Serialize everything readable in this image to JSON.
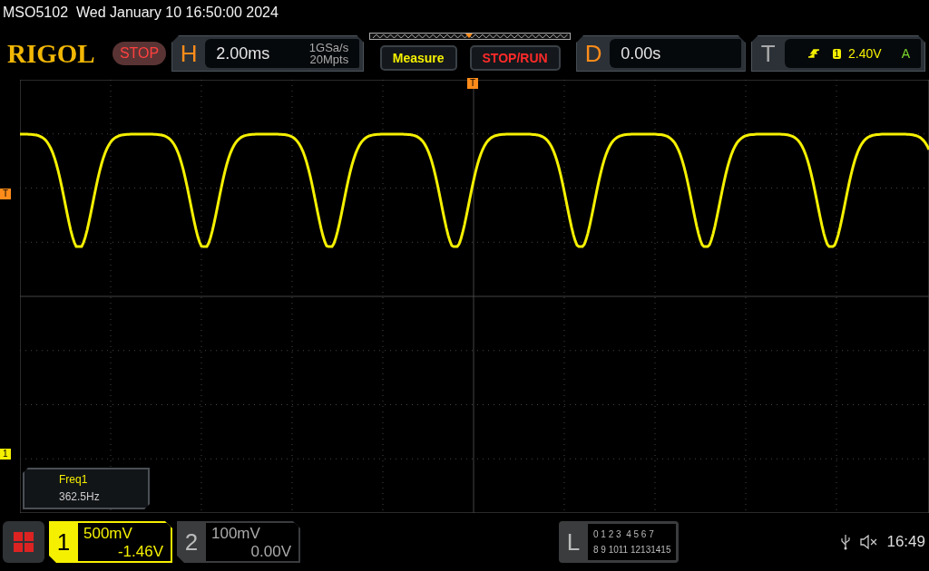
{
  "header": {
    "title": "MSO5102  Wed January 10 16:50:00 2024"
  },
  "toolbar": {
    "logo": "RIGOL",
    "run_state": "STOP",
    "horizontal": {
      "label": "H",
      "timebase": "2.00ms",
      "sample_rate": "1GSa/s",
      "memory_depth": "20Mpts"
    },
    "buttons": [
      {
        "label": "Measure",
        "kind": "measure"
      },
      {
        "label": "STOP/RUN",
        "kind": "stoprun"
      }
    ],
    "delay": {
      "label": "D",
      "value": "0.00s"
    },
    "trigger": {
      "label": "T",
      "source": "1",
      "level": "2.40V",
      "mode": "A"
    }
  },
  "plot": {
    "markers": [
      {
        "kind": "trigger-position",
        "label": "T"
      },
      {
        "kind": "trigger-level",
        "label": "T"
      },
      {
        "kind": "channel",
        "label": "1"
      }
    ],
    "measurements": [
      {
        "name": "Freq1",
        "value": "362.5Hz"
      }
    ]
  },
  "channels": [
    {
      "number": "1",
      "scale": "500mV",
      "offset": "-1.46V",
      "selected": true
    },
    {
      "number": "2",
      "scale": "100mV",
      "offset": "0.00V",
      "selected": false
    }
  ],
  "logic": {
    "label": "L",
    "row_1": "0 1 2 3  4 5 6 7",
    "row_2": "8 9 1011 12131415"
  },
  "status": {
    "time": "16:49"
  }
}
